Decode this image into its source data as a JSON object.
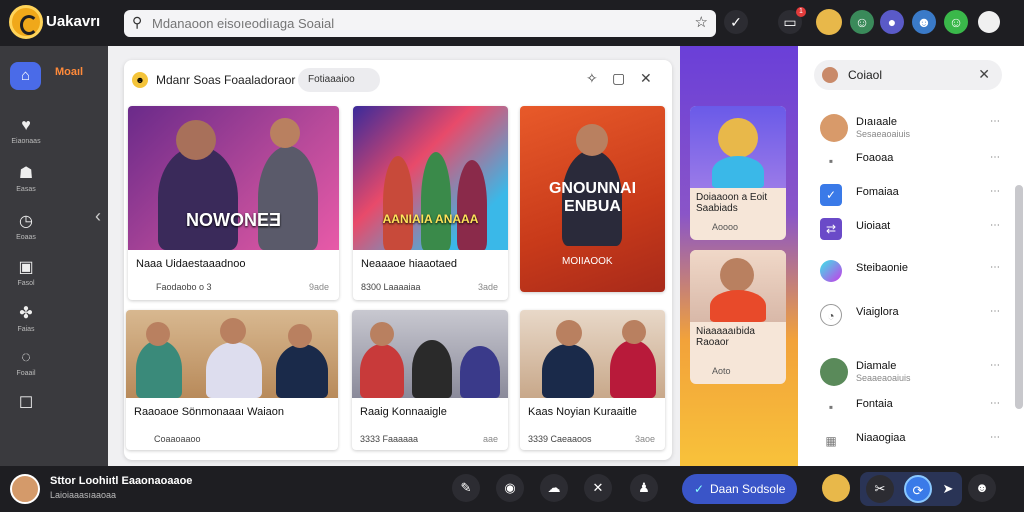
{
  "topbar": {
    "app_name": "Uakavrı",
    "search_placeholder": "Mdanaoon eisoıeodiıaga Soaial",
    "notif_count": "1"
  },
  "sidebar": {
    "home_label": "Moaıl",
    "items": [
      {
        "label": "Eiaonaas"
      },
      {
        "label": "Easas"
      },
      {
        "label": "Eoaas"
      },
      {
        "label": "Fasol"
      },
      {
        "label": "Faias"
      },
      {
        "label": "Foaail"
      },
      {
        "label": ""
      }
    ]
  },
  "panel": {
    "title": "Mdanr Soas Foaaladoraor",
    "chip": "Fotiaaaioo"
  },
  "cards": [
    {
      "banner": "NOWONEƎ",
      "title": "Naaa Uidaestaaadnoo",
      "meta": "Faodaobo o 3",
      "meta2": "9ade"
    },
    {
      "banner": "AANIAIA ANAAA",
      "title": "Neaaaoe hiaaotaed",
      "meta": "8300 Laaaaiaa",
      "meta2": "3ade"
    },
    {
      "banner": "GNOUNNAI ENBUA",
      "title": "MOIIAOOK",
      "meta": "",
      "meta2": ""
    },
    {
      "banner": "",
      "title": "Raaoaoe Sönmonaaaı Waiaon",
      "meta": "Coaaoaaoo",
      "meta2": ""
    },
    {
      "banner": "",
      "title": "Raaig Konnaaigle",
      "meta": "3333 Faaaaaa",
      "meta2": "aae"
    },
    {
      "banner": "",
      "title": "Kaas Noyian Kuraaitle",
      "meta": "3339 Caeaaoos",
      "meta2": "3aoe"
    }
  ],
  "promo": [
    {
      "title": "Doiaaoon a Eoit Saabiads",
      "meta": "Aoooo"
    },
    {
      "title": "Niaaaaaıbida Raoaor",
      "meta": "Aoto"
    }
  ],
  "right": {
    "search": "Coiaol",
    "items": [
      {
        "name": "Dıaıaale",
        "sub": "Sesaeaoaiuis"
      },
      {
        "name": "Foaoaa",
        "sub": ""
      },
      {
        "name": "Fomaiaa",
        "sub": ""
      },
      {
        "name": "Uioiaat",
        "sub": ""
      },
      {
        "name": "Steibaonie",
        "sub": ""
      },
      {
        "name": "Viaiglora",
        "sub": ""
      },
      {
        "name": "Diamale",
        "sub": "Seaaeaoaiuis"
      },
      {
        "name": "Fontaia",
        "sub": ""
      },
      {
        "name": "Niaaogiaa",
        "sub": ""
      }
    ]
  },
  "bottombar": {
    "name": "Sttor Loohiıtl Eaaonaoaaoe",
    "sub": "Laioiaaasıaaoaa",
    "pill": "Daan Sodsole"
  },
  "colors": {
    "accent": "#3a55c8",
    "purple": "#6a3fd8"
  }
}
